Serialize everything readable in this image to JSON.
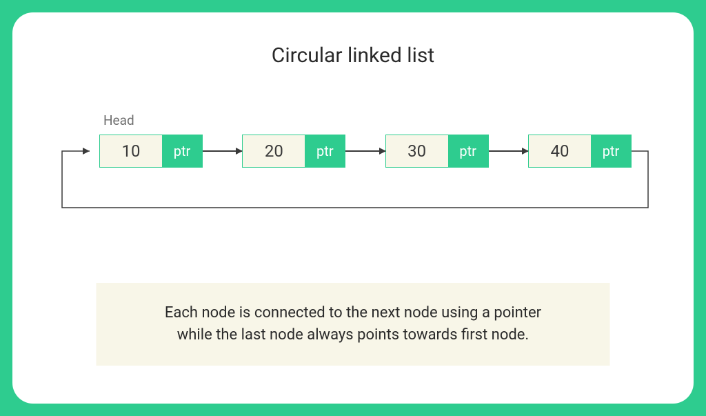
{
  "title": "Circular linked list",
  "head_label": "Head",
  "nodes": [
    {
      "data": "10",
      "ptr": "ptr"
    },
    {
      "data": "20",
      "ptr": "ptr"
    },
    {
      "data": "30",
      "ptr": "ptr"
    },
    {
      "data": "40",
      "ptr": "ptr"
    }
  ],
  "caption_line1": "Each node is connected to the next node using a pointer",
  "caption_line2": "while the last node always points towards first node."
}
